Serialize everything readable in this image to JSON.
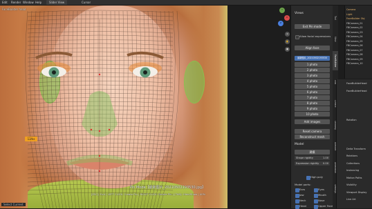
{
  "topbar": {
    "items": [
      "Edit",
      "Render",
      "Window",
      "Help",
      "Slider View"
    ],
    "right_label": "Cursor"
  },
  "viewport": {
    "header_label": "FaceBuilder head",
    "pin_mode_title": "Pin Mode【最新图片_20210502193530.jpg】",
    "hint_line": "[ESC]: Exit | LEFT CLICK: Create Pin | RIGHT CLICK: Delete Pin | [TAB]: Hide/Show | 40%",
    "pin_tag": "13/ks",
    "status_left": "Select Current"
  },
  "panel": {
    "tabs": [
      "Tool",
      "View",
      "FaceBuilder",
      "Edit",
      "Create",
      "Shading",
      "Blender",
      "Animation",
      "Settings"
    ],
    "views_header": "Views",
    "exit_pin_mode": "Exit Pin mode",
    "allow_facial_expressions": "Allow facial expressions",
    "align_face": "Align face",
    "active_view": "最新图片_20210502193530",
    "view_items": [
      "1 photo",
      "2 photo",
      "3 photo",
      "4 photo",
      "5 photo",
      "6 photo",
      "7 photo",
      "8 photo",
      "9 photo",
      "10 photo"
    ],
    "add_images": "Add images",
    "reset_camera": "Reset camera",
    "reconstruct": "Reconstruct mesh",
    "model_header": "Model",
    "model_buttons": "建模",
    "shape_rigidity_label": "Shape rigidity",
    "shape_rigidity_value": "1.00",
    "expression_rigidity_label": "Expression rigidity",
    "expression_rigidity_value": "0.00",
    "quality_label": "High poly",
    "model_parts_label": "Model parts:",
    "model_parts": [
      {
        "name": "Ears",
        "on": true
      },
      {
        "name": "Eyes",
        "on": true
      },
      {
        "name": "Jaw",
        "on": true
      },
      {
        "name": "Mouth",
        "on": true
      },
      {
        "name": "Neck",
        "on": true
      },
      {
        "name": "Nose",
        "on": true
      },
      {
        "name": "Head",
        "on": true
      },
      {
        "name": "Upper Face",
        "on": true
      }
    ]
  },
  "outliner": {
    "items": [
      "Camera",
      "Light",
      "FaceBuilder Obj",
      "FBCamera_01",
      "FBCamera_02",
      "FBCamera_03",
      "FBCamera_04",
      "FBCamera_05",
      "FBCamera_06",
      "FBCamera_07",
      "FBCamera_08",
      "FBCamera_09",
      "FBCamera_10"
    ]
  },
  "properties": {
    "rows": [
      "FaceBuilderHead",
      "FaceBuilderHead",
      "",
      "",
      "",
      "Rotation",
      "",
      "",
      "",
      "Delta Transform",
      "Relations",
      "Collections",
      "Instancing",
      "Motion Paths",
      "Visibility",
      "Viewport Display",
      "Line Art"
    ]
  },
  "colors": {
    "accent": "#4772b3",
    "mesh_line": "#3a2b22",
    "pin": "#e03030",
    "green_mask": "#7cc45a"
  }
}
